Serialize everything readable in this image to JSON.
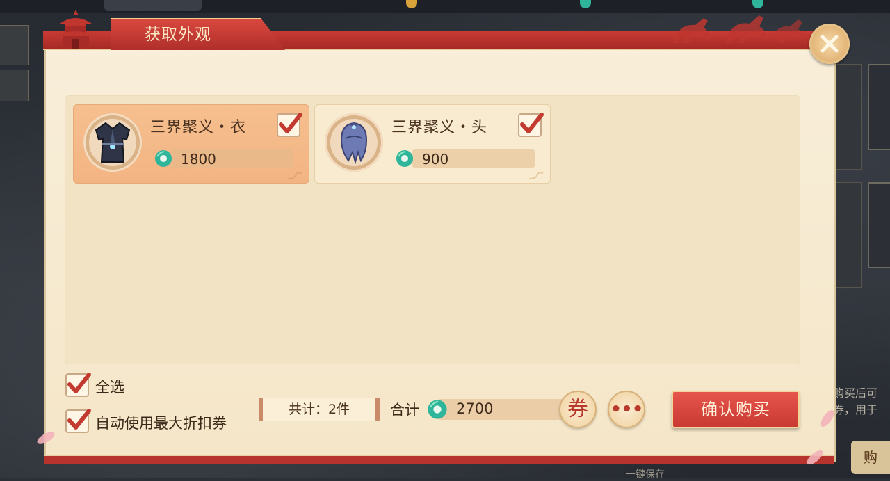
{
  "dialog": {
    "title": "获取外观",
    "close_icon": "close-icon"
  },
  "items": [
    {
      "name": "三界聚义・衣",
      "price": "1800",
      "checked": true,
      "selected": true,
      "icon": "robe-costume-icon"
    },
    {
      "name": "三界聚义・头",
      "price": "900",
      "checked": true,
      "selected": false,
      "icon": "hair-costume-icon"
    }
  ],
  "options": {
    "select_all_label": "全选",
    "select_all_checked": true,
    "auto_coupon_label": "自动使用最大折扣券",
    "auto_coupon_checked": true
  },
  "summary": {
    "count_text": "共计：2件",
    "total_label": "合计",
    "total_value": "2700",
    "currency_icon": "jade-coin-icon"
  },
  "buttons": {
    "coupon_label": "券",
    "more_label": "•••",
    "confirm_label": "确认购买"
  },
  "background": {
    "right_side_text_1": "购买后可",
    "right_side_text_2": "券，用于",
    "buy_button_label": "购",
    "bottom_text": "一键保存"
  },
  "colors": {
    "header_red": "#b02f2a",
    "panel_bg": "#f5e6c8",
    "selected_card": "#f3b483",
    "confirm_button": "#c93a33",
    "jade": "#2fb59a"
  }
}
